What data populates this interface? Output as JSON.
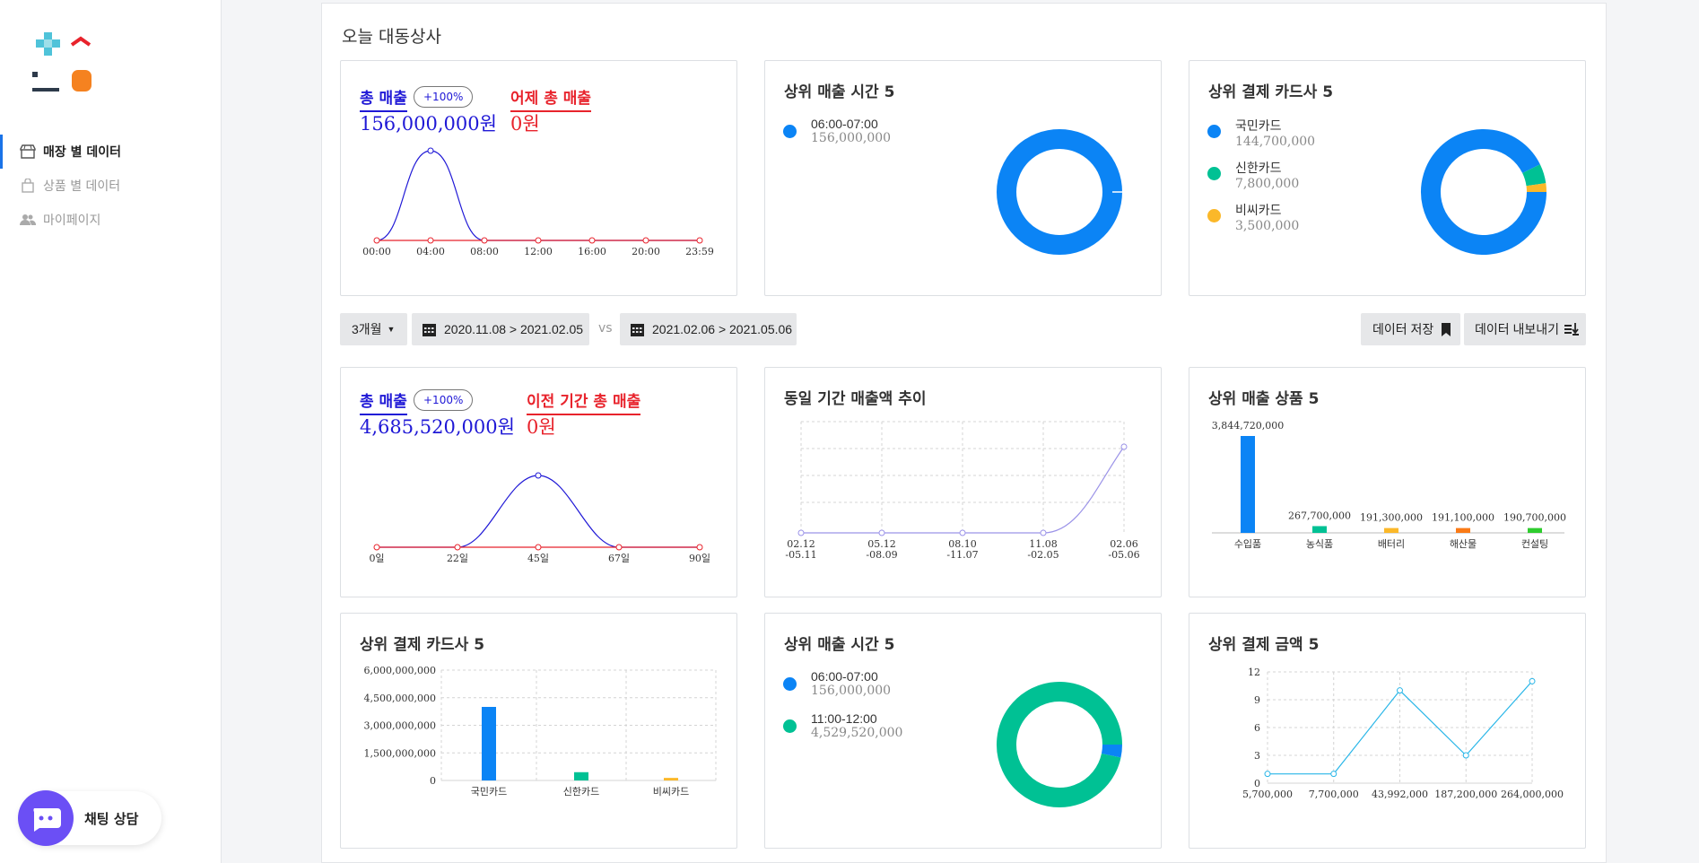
{
  "sidebar": {
    "items": [
      {
        "label": "매장 별 데이터",
        "icon": "store-icon",
        "active": true
      },
      {
        "label": "상품 별 데이터",
        "icon": "shopping-bag-icon",
        "active": false
      },
      {
        "label": "마이페이지",
        "icon": "users-icon",
        "active": false
      }
    ],
    "chat_label": "채팅 상담"
  },
  "main": {
    "title": "오늘 대동상사",
    "today": {
      "total_label": "총 매출",
      "badge": "+100%",
      "total_value": "156,000,000원",
      "prev_label": "어제 총 매출",
      "prev_value": "0원",
      "x_ticks": [
        "00:00",
        "04:00",
        "08:00",
        "12:00",
        "16:00",
        "20:00",
        "23:59"
      ]
    },
    "top_time": {
      "title": "상위 매출 시간 5",
      "items": [
        {
          "name": "06:00-07:00",
          "value": "156,000,000"
        }
      ]
    },
    "top_card": {
      "title": "상위 결제 카드사 5",
      "items": [
        {
          "name": "국민카드",
          "value": "144,700,000"
        },
        {
          "name": "신한카드",
          "value": "7,800,000"
        },
        {
          "name": "비씨카드",
          "value": "3,500,000"
        }
      ]
    },
    "toolbar": {
      "period": "3개월",
      "range1": "2020.11.08 > 2021.02.05",
      "vs": "vs",
      "range2": "2021.02.06 > 2021.05.06",
      "save": "데이터 저장",
      "export": "데이터 내보내기"
    },
    "period": {
      "total_label": "총 매출",
      "badge": "+100%",
      "total_value": "4,685,520,000원",
      "prev_label": "이전 기간 총 매출",
      "prev_value": "0원",
      "x_ticks": [
        "0일",
        "22일",
        "45일",
        "67일",
        "90일"
      ]
    },
    "trend": {
      "title": "동일 기간 매출액 추이",
      "x_ticks": [
        [
          "02.12",
          "-05.11"
        ],
        [
          "05.12",
          "-08.09"
        ],
        [
          "08.10",
          "-11.07"
        ],
        [
          "11.08",
          "-02.05"
        ],
        [
          "02.06",
          "-05.06"
        ]
      ]
    },
    "top_product": {
      "title": "상위 매출 상품 5"
    },
    "card_bar": {
      "title": "상위 결제 카드사 5"
    },
    "time2": {
      "title": "상위 매출 시간 5",
      "items": [
        {
          "name": "06:00-07:00",
          "value": "156,000,000"
        },
        {
          "name": "11:00-12:00",
          "value": "4,529,520,000"
        }
      ]
    },
    "amount": {
      "title": "상위 결제 금액 5"
    }
  },
  "colors": {
    "blue": "#0b84f5",
    "teal": "#00c194",
    "yellow": "#fbb829",
    "orange": "#fa7a16",
    "green": "#2ecc2e",
    "navy_line": "#1f18d6",
    "red_line": "#e8232c",
    "lavender": "#9b93e8",
    "sky": "#29b6e8"
  },
  "chart_data": [
    {
      "id": "today_sales",
      "type": "line",
      "x": [
        "00:00",
        "04:00",
        "08:00",
        "12:00",
        "16:00",
        "20:00",
        "23:59"
      ],
      "series": [
        {
          "values": [
            0,
            156000000,
            0,
            0,
            0,
            0,
            0
          ]
        },
        {
          "values": [
            0,
            0,
            0,
            0,
            0,
            0,
            0
          ]
        }
      ]
    },
    {
      "id": "top_time_donut",
      "type": "pie",
      "labels": [
        "06:00-07:00"
      ],
      "values": [
        156000000
      ]
    },
    {
      "id": "top_card_donut",
      "type": "pie",
      "labels": [
        "국민카드",
        "신한카드",
        "비씨카드"
      ],
      "values": [
        144700000,
        7800000,
        3500000
      ]
    },
    {
      "id": "period_sales",
      "type": "line",
      "x": [
        "0일",
        "22일",
        "45일",
        "67일",
        "90일"
      ],
      "series": [
        {
          "values": [
            0,
            0,
            4685520000,
            0,
            0
          ]
        },
        {
          "values": [
            0,
            0,
            0,
            0,
            0
          ]
        }
      ]
    },
    {
      "id": "trend",
      "type": "line",
      "x": [
        "02.12 -05.11",
        "05.12 -08.09",
        "08.10 -11.07",
        "11.08 -02.05",
        "02.06 -05.06"
      ],
      "series": [
        {
          "values": [
            0,
            0,
            0,
            0,
            4685520000
          ]
        }
      ]
    },
    {
      "id": "top_product",
      "type": "bar",
      "categories": [
        "수입품",
        "농식품",
        "배터리",
        "해산물",
        "컨설팅"
      ],
      "values": [
        3844720000,
        267700000,
        191300000,
        191100000,
        190700000
      ],
      "value_labels": [
        "3,844,720,000",
        "267,700,000",
        "191,300,000",
        "191,100,000",
        "190,700,000"
      ]
    },
    {
      "id": "card_bar",
      "type": "bar",
      "categories": [
        "국민카드",
        "신한카드",
        "비씨카드"
      ],
      "values": [
        4000000000,
        450000000,
        140000000
      ],
      "y_ticks": [
        "0",
        "1,500,000,000",
        "3,000,000,000",
        "4,500,000,000",
        "6,000,000,000"
      ],
      "ylim": [
        0,
        6000000000
      ]
    },
    {
      "id": "time2_donut",
      "type": "pie",
      "labels": [
        "06:00-07:00",
        "11:00-12:00"
      ],
      "values": [
        156000000,
        4529520000
      ]
    },
    {
      "id": "amount_line",
      "type": "line",
      "x": [
        "5,700,000",
        "7,700,000",
        "43,992,000",
        "187,200,000",
        "264,000,000"
      ],
      "series": [
        {
          "values": [
            1,
            1,
            10,
            3,
            11
          ]
        }
      ],
      "y_ticks": [
        "0",
        "3",
        "6",
        "9",
        "12"
      ],
      "ylim": [
        0,
        12
      ]
    }
  ]
}
